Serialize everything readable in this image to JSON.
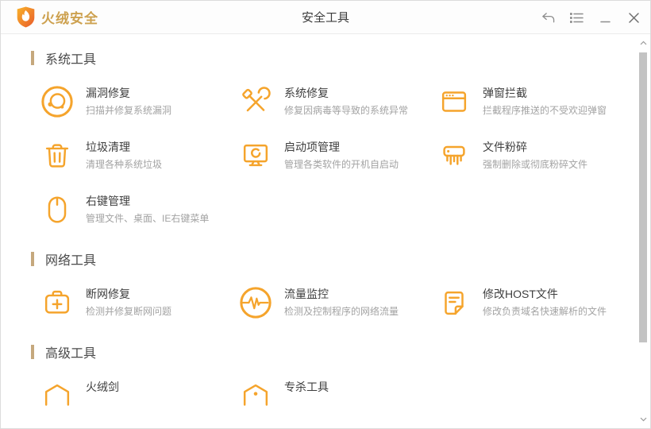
{
  "titlebar": {
    "brand": "火绒安全",
    "title": "安全工具"
  },
  "colors": {
    "accent": "#F5A42C",
    "brand_text": "#CDA14F",
    "section_bar": "#C5A87D",
    "tool_title": "#3F3F3F",
    "tool_desc": "#A3A3A3"
  },
  "sections": [
    {
      "title": "系统工具",
      "tools": [
        {
          "title": "漏洞修复",
          "desc": "扫描并修复系统漏洞",
          "icon": "vulnerability-scan-icon"
        },
        {
          "title": "系统修复",
          "desc": "修复因病毒等导致的系统异常",
          "icon": "crossed-tools-icon"
        },
        {
          "title": "弹窗拦截",
          "desc": "拦截程序推送的不受欢迎弹窗",
          "icon": "popup-window-icon"
        },
        {
          "title": "垃圾清理",
          "desc": "清理各种系统垃圾",
          "icon": "trash-icon"
        },
        {
          "title": "启动项管理",
          "desc": "管理各类软件的开机自启动",
          "icon": "monitor-power-icon"
        },
        {
          "title": "文件粉碎",
          "desc": "强制删除或彻底粉碎文件",
          "icon": "shredder-icon"
        },
        {
          "title": "右键管理",
          "desc": "管理文件、桌面、IE右键菜单",
          "icon": "mouse-icon"
        }
      ]
    },
    {
      "title": "网络工具",
      "tools": [
        {
          "title": "断网修复",
          "desc": "检测并修复断网问题",
          "icon": "first-aid-kit-icon"
        },
        {
          "title": "流量监控",
          "desc": "检测及控制程序的网络流量",
          "icon": "pulse-circle-icon"
        },
        {
          "title": "修改HOST文件",
          "desc": "修改负责域名快速解析的文件",
          "icon": "document-edit-icon"
        }
      ]
    },
    {
      "title": "高级工具",
      "tools": [
        {
          "title": "火绒剑",
          "desc": "",
          "icon": "shield-icon"
        },
        {
          "title": "专杀工具",
          "desc": "",
          "icon": "shield-dot-icon"
        }
      ]
    }
  ]
}
